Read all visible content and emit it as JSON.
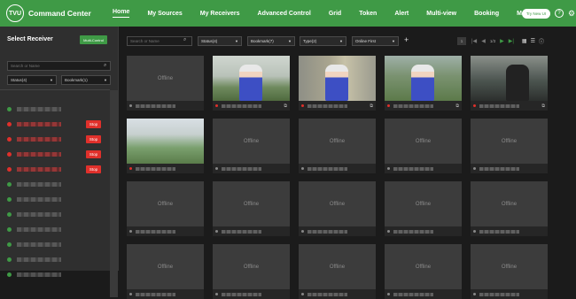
{
  "app": {
    "logo_text": "TVU",
    "title": "Command Center"
  },
  "nav": [
    {
      "label": "Home",
      "active": true
    },
    {
      "label": "My Sources",
      "active": false
    },
    {
      "label": "My Receivers",
      "active": false
    },
    {
      "label": "Advanced Control",
      "active": false
    },
    {
      "label": "Grid",
      "active": false
    },
    {
      "label": "Token",
      "active": false
    },
    {
      "label": "Alert",
      "active": false
    },
    {
      "label": "Multi-view",
      "active": false
    },
    {
      "label": "Booking",
      "active": false
    },
    {
      "label": "More ▾",
      "active": false
    }
  ],
  "header_right": {
    "try_new_label": "Try New UI",
    "help_icon": "help-icon",
    "settings_icon": "settings-icon"
  },
  "sidebar": {
    "title": "Select Receiver",
    "multi_control_label": "Multi-Control",
    "search_placeholder": "Search or Name",
    "status_filter": "Status(4)",
    "bookmark_filter": "Bookmark(1)",
    "stop_label": "Stop",
    "receivers": [
      {
        "status": "idle"
      },
      {
        "status": "live"
      },
      {
        "status": "live"
      },
      {
        "status": "live"
      },
      {
        "status": "live"
      },
      {
        "status": "idle"
      },
      {
        "status": "idle"
      },
      {
        "status": "idle"
      },
      {
        "status": "idle"
      },
      {
        "status": "idle"
      },
      {
        "status": "idle"
      },
      {
        "status": "idle"
      }
    ]
  },
  "filters": {
    "search_placeholder": "Search or Name",
    "status": "Status(4)",
    "bookmark": "Bookmark(7)",
    "type": "Type(2)",
    "sort": "Online First",
    "page": "1",
    "page_total": "1/3"
  },
  "tiles": {
    "offline_label": "Offline",
    "items": [
      {
        "state": "offline"
      },
      {
        "state": "live"
      },
      {
        "state": "live"
      },
      {
        "state": "live"
      },
      {
        "state": "live"
      },
      {
        "state": "live"
      },
      {
        "state": "offline"
      },
      {
        "state": "offline"
      },
      {
        "state": "offline"
      },
      {
        "state": "offline"
      },
      {
        "state": "offline"
      },
      {
        "state": "offline"
      },
      {
        "state": "offline"
      },
      {
        "state": "offline"
      },
      {
        "state": "offline"
      },
      {
        "state": "offline"
      },
      {
        "state": "offline"
      },
      {
        "state": "offline"
      },
      {
        "state": "offline"
      },
      {
        "state": "offline"
      }
    ]
  },
  "colors": {
    "brand": "#3f9a46",
    "stop": "#e0302b",
    "live_dot": "#e0302b"
  }
}
